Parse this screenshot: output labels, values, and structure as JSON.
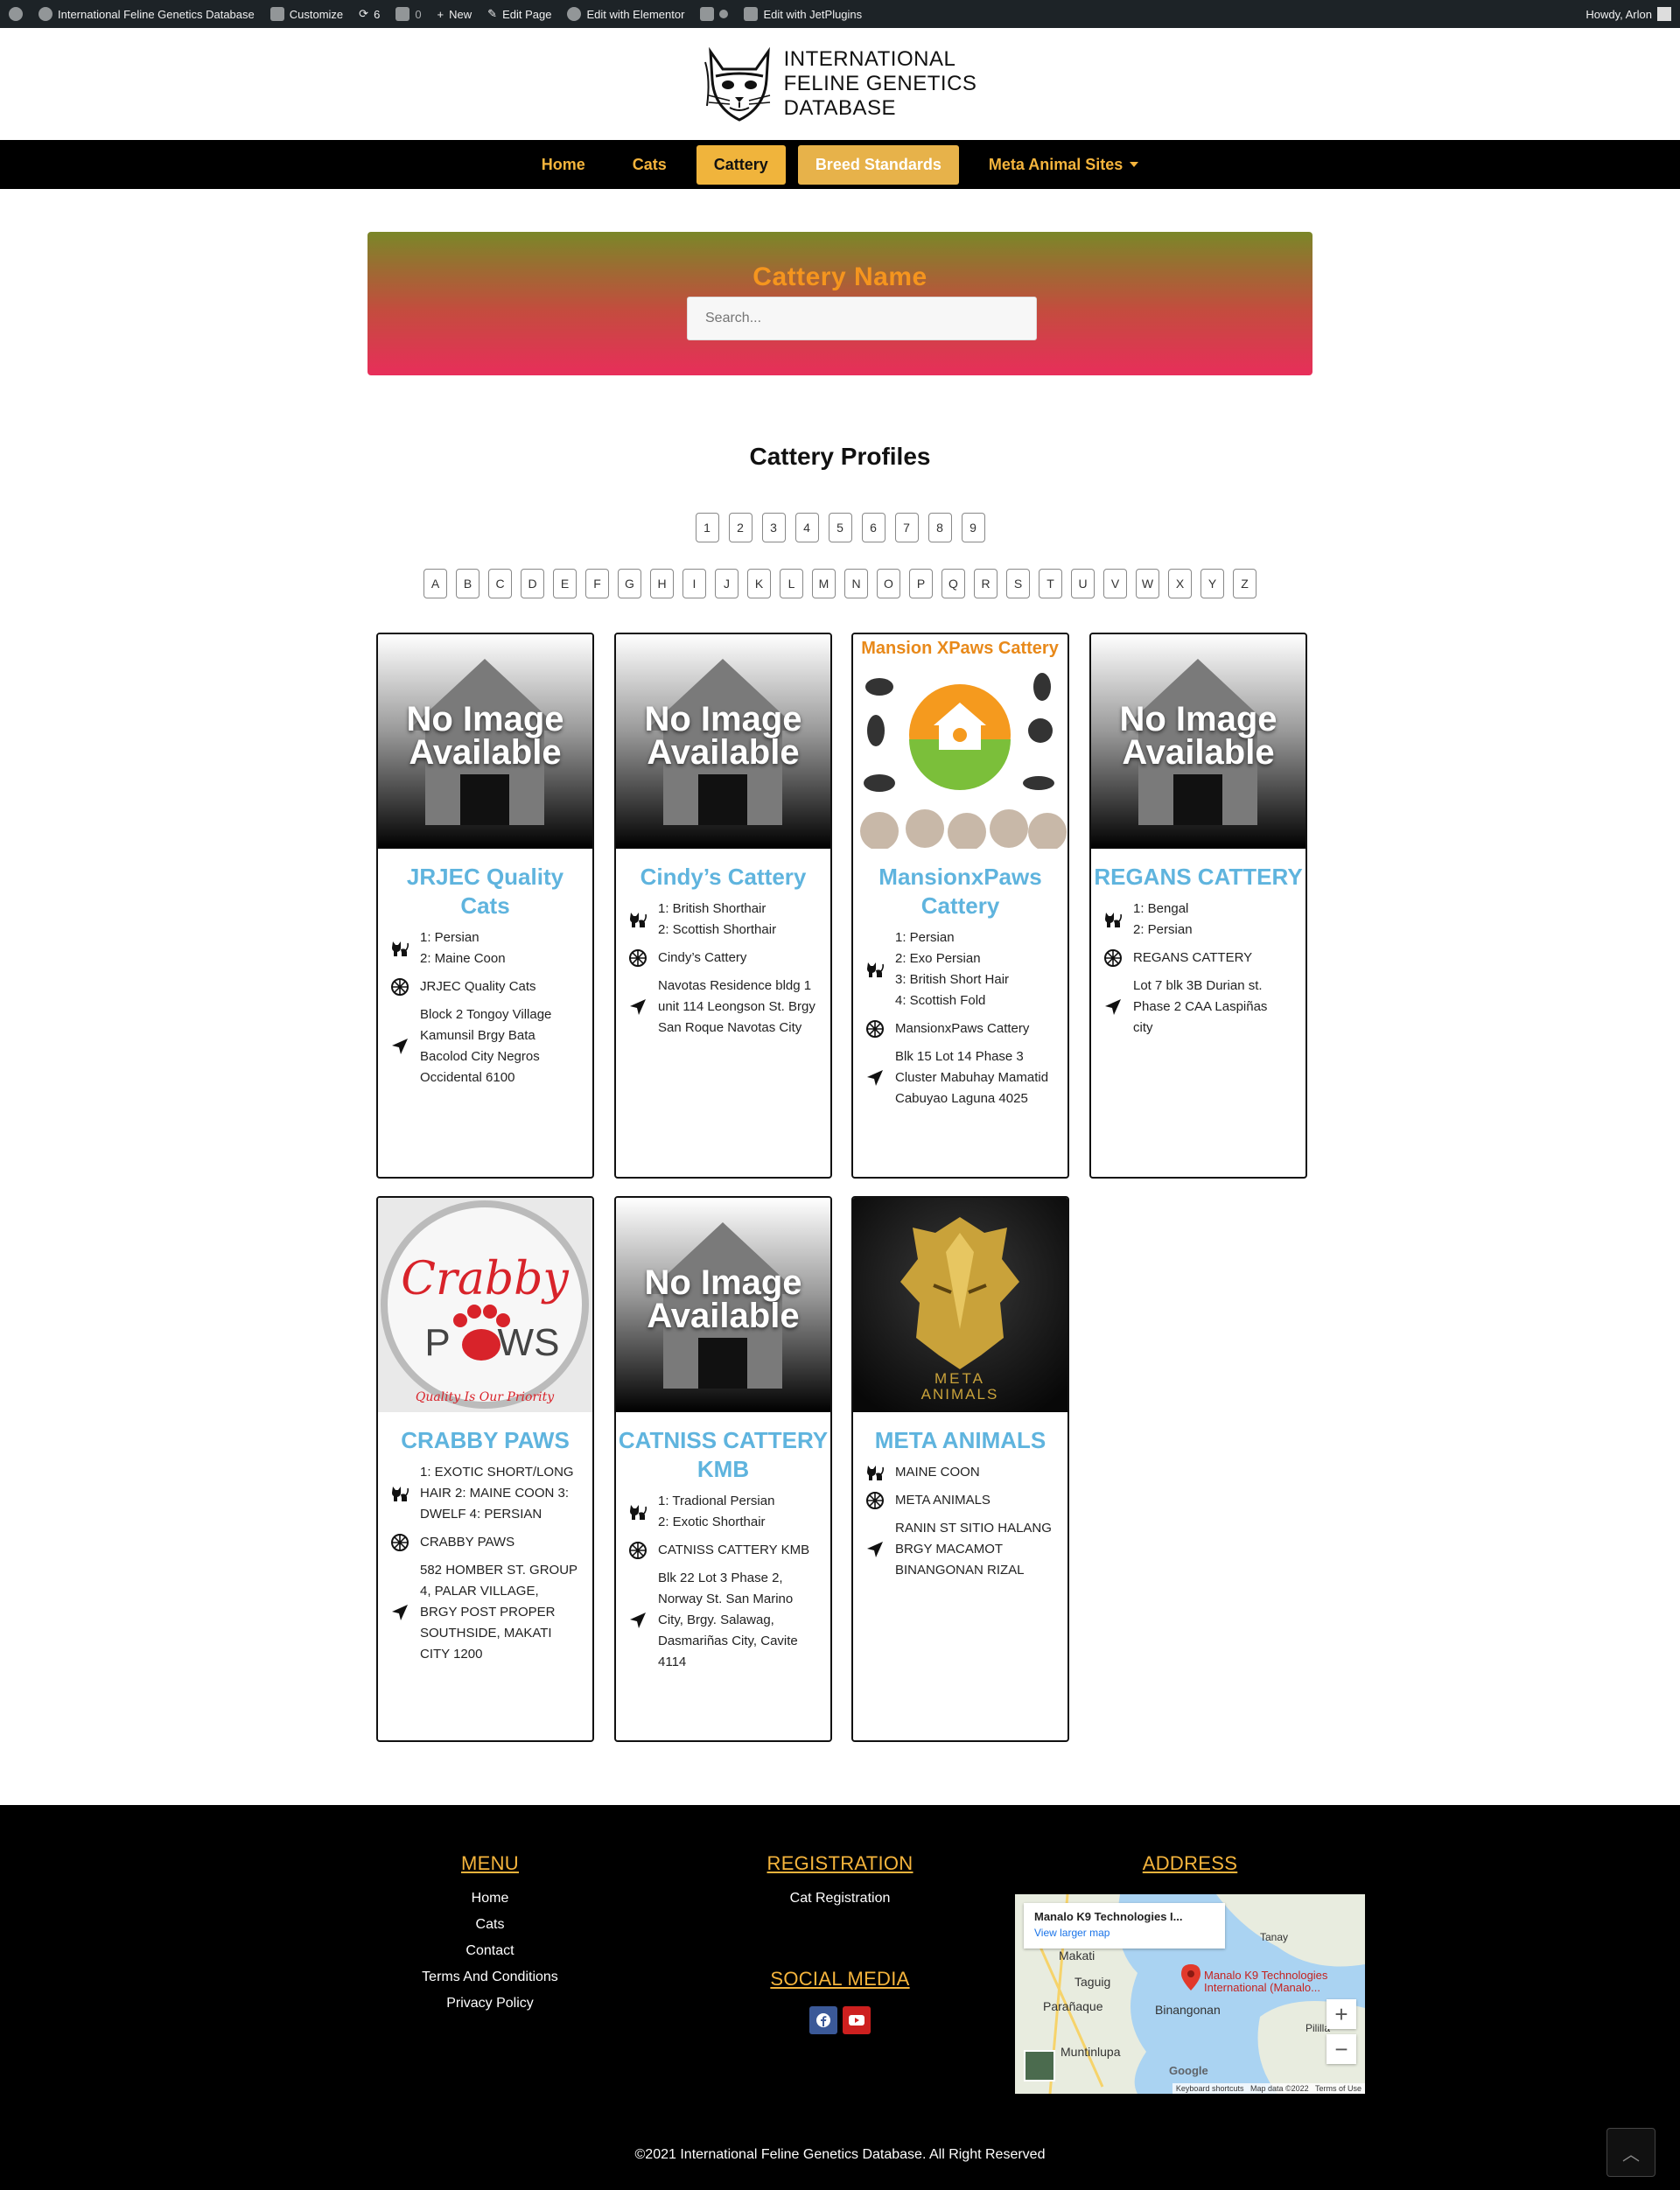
{
  "adminbar": {
    "site_name": "International Feline Genetics Database",
    "customize": "Customize",
    "updates": "6",
    "comments": "0",
    "new": "New",
    "edit_page": "Edit Page",
    "elementor": "Edit with Elementor",
    "jetplugins": "Edit with JetPlugins",
    "howdy": "Howdy, Arlon"
  },
  "logo": {
    "line1": "INTERNATIONAL",
    "line2": "FELINE GENETICS",
    "line3": "DATABASE"
  },
  "nav": {
    "items": [
      "Home",
      "Cats",
      "Cattery",
      "Breed Standards",
      "Meta Animal Sites"
    ]
  },
  "hero": {
    "title": "Cattery Name",
    "placeholder": "Search..."
  },
  "section_title": "Cattery Profiles",
  "pagination": [
    "1",
    "2",
    "3",
    "4",
    "5",
    "6",
    "7",
    "8",
    "9"
  ],
  "letters": [
    "A",
    "B",
    "C",
    "D",
    "E",
    "F",
    "G",
    "H",
    "I",
    "J",
    "K",
    "L",
    "M",
    "N",
    "O",
    "P",
    "Q",
    "R",
    "S",
    "T",
    "U",
    "V",
    "W",
    "X",
    "Y",
    "Z"
  ],
  "no_image": {
    "line1": "No Image",
    "line2": "Available"
  },
  "cards": [
    {
      "title": "JRJEC Quality Cats",
      "breeds": "1: Persian\n2: Maine Coon",
      "cattery": "JRJEC Quality Cats",
      "address": "Block 2 Tongoy Village Kamunsil Brgy Bata Bacolod City Negros Occidental 6100",
      "image": "no-image"
    },
    {
      "title": "Cindy’s Cattery",
      "breeds": "1: British Shorthair\n2: Scottish Shorthair",
      "cattery": "Cindy’s Cattery",
      "address": "Navotas Residence bldg 1 unit 114 Leongson St. Brgy San Roque Navotas City",
      "image": "no-image"
    },
    {
      "title": "MansionxPaws Cattery",
      "breeds": "1: Persian\n2: Exo Persian\n3: British Short Hair\n4: Scottish Fold",
      "cattery": "MansionxPaws Cattery",
      "address": "Blk 15 Lot 14 Phase 3 Cluster Mabuhay Mamatid Cabuyao Laguna 4025",
      "image": "mansionxpaws-logo",
      "image_text": "Mansion XPaws Cattery"
    },
    {
      "title": "REGANS CATTERY",
      "breeds": "1: Bengal\n2: Persian",
      "cattery": "REGANS CATTERY",
      "address": "Lot 7 blk 3B Durian st. Phase 2 CAA Laspiñas city",
      "image": "no-image"
    },
    {
      "title": "CRABBY PAWS",
      "breeds": "1: EXOTIC SHORT/LONG HAIR 2: MAINE COON 3: DWELF 4: PERSIAN",
      "cattery": "CRABBY PAWS",
      "address": "582 HOMBER ST. GROUP 4, PALAR VILLAGE, BRGY POST PROPER SOUTHSIDE, MAKATI CITY 1200",
      "image": "crabby-paws-logo",
      "image_text_1": "Crabby",
      "image_text_2": "P",
      "image_text_3": "WS",
      "image_tagline": "Quality Is Our Priority"
    },
    {
      "title": "CATNISS CATTERY KMB",
      "breeds": "1: Tradional Persian\n2: Exotic Shorthair",
      "cattery": "CATNISS CATTERY KMB",
      "address": "Blk 22 Lot 3 Phase 2, Norway St. San Marino City, Brgy. Salawag, Dasmariñas City, Cavite 4114",
      "image": "no-image"
    },
    {
      "title": "META ANIMALS",
      "breeds": "MAINE COON",
      "cattery": "META ANIMALS",
      "address": "RANIN ST SITIO HALANG BRGY MACAMOT BINANGONAN RIZAL",
      "image": "meta-animals-logo",
      "image_text_1": "META",
      "image_text_2": "ANIMALS"
    }
  ],
  "footer": {
    "menu_title": "MENU",
    "menu_items": [
      "Home",
      "Cats",
      "Contact",
      "Terms And Conditions",
      "Privacy Policy"
    ],
    "registration_title": "REGISTRATION",
    "registration_items": [
      "Cat Registration"
    ],
    "social_title": "SOCIAL MEDIA",
    "address_title": "ADDRESS",
    "map_place": "Manalo K9 Technologies I...",
    "map_link": "View larger map",
    "map_pin_label": "Manalo K9 Technologies International (Manalo...",
    "map_labels": [
      "Makati",
      "Taguig",
      "Parañaque",
      "Muntinlupa",
      "Binangonan",
      "Tanay",
      "Pililla",
      "Google"
    ],
    "map_footer": "Keyboard shortcuts   Map data ©2022   Terms of Use",
    "copyright": "©2021 International Feline Genetics Database. All Right Reserved"
  },
  "colors": {
    "accent": "#f5b43c",
    "card_title": "#5fb4de",
    "facebook": "#3b5998",
    "youtube": "#cd201f"
  }
}
